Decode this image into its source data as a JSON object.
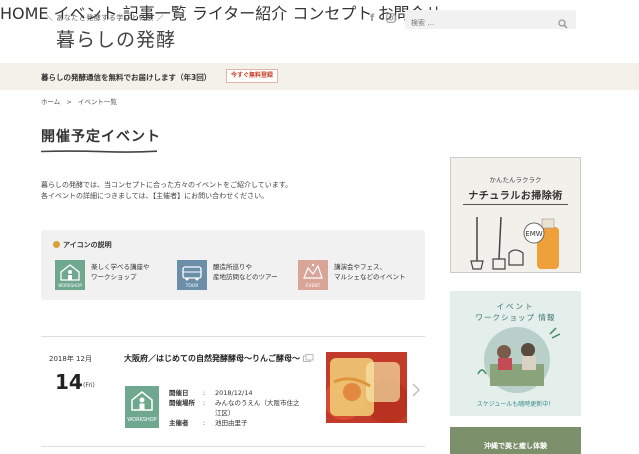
{
  "header": {
    "tagline": "＼ あなたと発酵する学びと体験 ／",
    "logo": "暮らしの発酵",
    "social": [
      "f",
      "◎"
    ],
    "search_placeholder": "検索 …",
    "nav": [
      "HOME",
      "イベント",
      "記事一覧",
      "ライター紹介",
      "コンセプト",
      "お問合せ"
    ]
  },
  "notice": {
    "text": "暮らしの発酵通信を無料でお届けします（年3回）",
    "button": "今すぐ無料登録"
  },
  "breadcrumb": [
    "ホーム",
    ">",
    "イベント一覧"
  ],
  "page": {
    "title": "開催予定イベント",
    "intro_line1": "暮らしの発酵では、当コンセプトに合った方々のイベントをご紹介しています。",
    "intro_line2": "各イベントの詳細につきましては、【主催者】にお問い合わせください。"
  },
  "legend": {
    "title": "アイコンの説明",
    "items": [
      {
        "icon": "workshop-icon",
        "label": "WORKSHOP",
        "line1": "楽しく学べる講座や",
        "line2": "ワークショップ",
        "color": "#6fa88f"
      },
      {
        "icon": "tour-icon",
        "label": "TOUR",
        "line1": "醸造所巡りや",
        "line2": "産地訪問などのツアー",
        "color": "#6b8fa8"
      },
      {
        "icon": "event-icon",
        "label": "EVENT",
        "line1": "講演会やフェス、",
        "line2": "マルシェなどのイベント",
        "color": "#d9a598"
      }
    ]
  },
  "event": {
    "year_month": "2018年 12月",
    "day": "14",
    "dow": "(Fri)",
    "title": "大阪府／はじめての自然発酵酵母〜りんご酵母〜",
    "badge": "WORKSHOP",
    "rows": [
      {
        "k": "開催日",
        "v": "2018/12/14"
      },
      {
        "k": "開催場所",
        "v": "みんなのうえん（大阪市住之江区）"
      },
      {
        "k": "主催者",
        "v": "池田由里子"
      }
    ],
    "colon": ":"
  },
  "sidebar": {
    "ad1_line1": "かんたんラクラク",
    "ad1_line2": "ナチュラルお掃除術",
    "ad1_bottle": "EMW",
    "ad2_line1": "イベント",
    "ad2_line2": "ワークショップ 情報",
    "ad2_line3": "スケジュールも随時更新中！",
    "ad3_line1": "沖縄で美と癒し体験"
  }
}
